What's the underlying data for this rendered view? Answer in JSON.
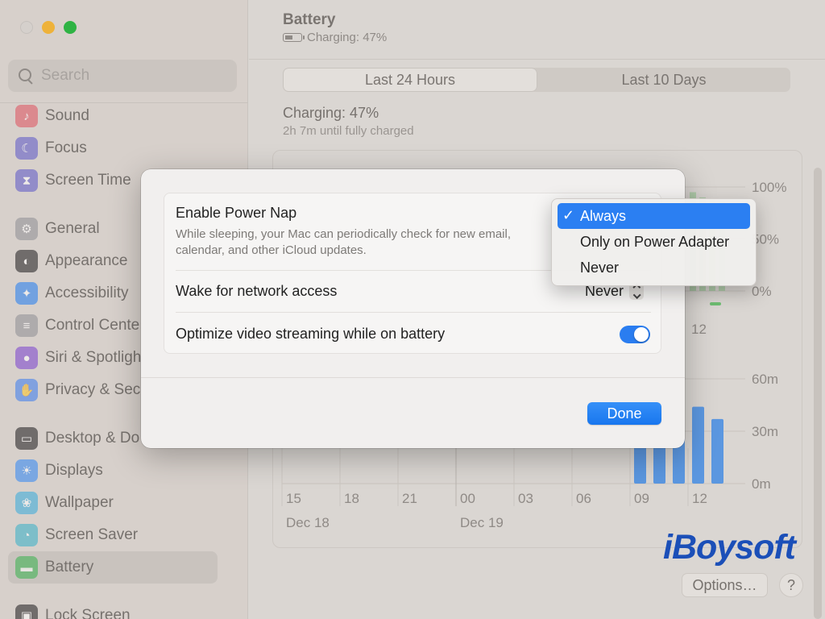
{
  "window": {
    "title": "Battery",
    "subtitle": "Charging: 47%"
  },
  "search": {
    "placeholder": "Search"
  },
  "sidebar": {
    "items": [
      {
        "label": "Sound",
        "icon": "speaker-icon",
        "color": "#e0505e"
      },
      {
        "label": "Focus",
        "icon": "moon-icon",
        "color": "#5a55c9"
      },
      {
        "label": "Screen Time",
        "icon": "hourglass-icon",
        "color": "#5a55c9"
      },
      {
        "label": "General",
        "icon": "gear-icon",
        "color": "#8e8e93"
      },
      {
        "label": "Appearance",
        "icon": "appearance-icon",
        "color": "#1c1c1e"
      },
      {
        "label": "Accessibility",
        "icon": "accessibility-icon",
        "color": "#1e7cf2"
      },
      {
        "label": "Control Cente",
        "icon": "control-center-icon",
        "color": "#8e8e93"
      },
      {
        "label": "Siri & Spotligh",
        "icon": "siri-icon",
        "color": "#7a3fcf"
      },
      {
        "label": "Privacy & Sec",
        "icon": "hand-icon",
        "color": "#3a7bf0"
      },
      {
        "label": "Desktop & Do",
        "icon": "dock-icon",
        "color": "#1c1c1e"
      },
      {
        "label": "Displays",
        "icon": "sun-icon",
        "color": "#2f86f5"
      },
      {
        "label": "Wallpaper",
        "icon": "flower-icon",
        "color": "#34aadc"
      },
      {
        "label": "Screen Saver",
        "icon": "screensaver-icon",
        "color": "#35b0c9"
      },
      {
        "label": "Battery",
        "icon": "battery-icon",
        "color": "#37b24d"
      },
      {
        "label": "Lock Screen",
        "icon": "lock-icon",
        "color": "#1c1c1e"
      }
    ]
  },
  "tabs": [
    {
      "label": "Last 24 Hours"
    },
    {
      "label": "Last 10 Days"
    }
  ],
  "status": {
    "title": "Charging: 47%",
    "subtitle": "2h 7m until fully charged"
  },
  "chart_data": [
    {
      "type": "bar",
      "title": "",
      "y_ticks": [
        "100%",
        "50%",
        "0%"
      ],
      "x_ticks": [
        "12"
      ],
      "values_percent": [
        95,
        90,
        88,
        86
      ]
    },
    {
      "type": "bar",
      "title": "",
      "x_ticks": [
        "15",
        "18",
        "21",
        "00",
        "03",
        "06",
        "09",
        "12"
      ],
      "date_labels": [
        "Dec 18",
        "Dec 19"
      ],
      "y_ticks": [
        "60m",
        "30m",
        "0m"
      ],
      "ylim": [
        0,
        60
      ],
      "bars": [
        {
          "x": "09",
          "value": 28
        },
        {
          "x": "10",
          "value": 33
        },
        {
          "x": "11",
          "value": 37
        },
        {
          "x": "12",
          "value": 44
        },
        {
          "x": "13",
          "value": 37
        }
      ],
      "bar_color": "#5b97e0"
    }
  ],
  "brand": {
    "name": "iBoysoft"
  },
  "footer": {
    "options_label": "Options…",
    "help_label": "?"
  },
  "sheet": {
    "power_nap": {
      "title": "Enable Power Nap",
      "description": "While sleeping, your Mac can periodically check for new email, calendar, and other iCloud updates."
    },
    "network": {
      "title": "Wake for network access",
      "value": "Never"
    },
    "video": {
      "title": "Optimize video streaming while on battery",
      "on": true
    },
    "done_label": "Done"
  },
  "menu": {
    "checkmark": "✓",
    "items": [
      {
        "label": "Always",
        "selected": true
      },
      {
        "label": "Only on Power Adapter",
        "selected": false
      },
      {
        "label": "Never",
        "selected": false
      }
    ]
  }
}
